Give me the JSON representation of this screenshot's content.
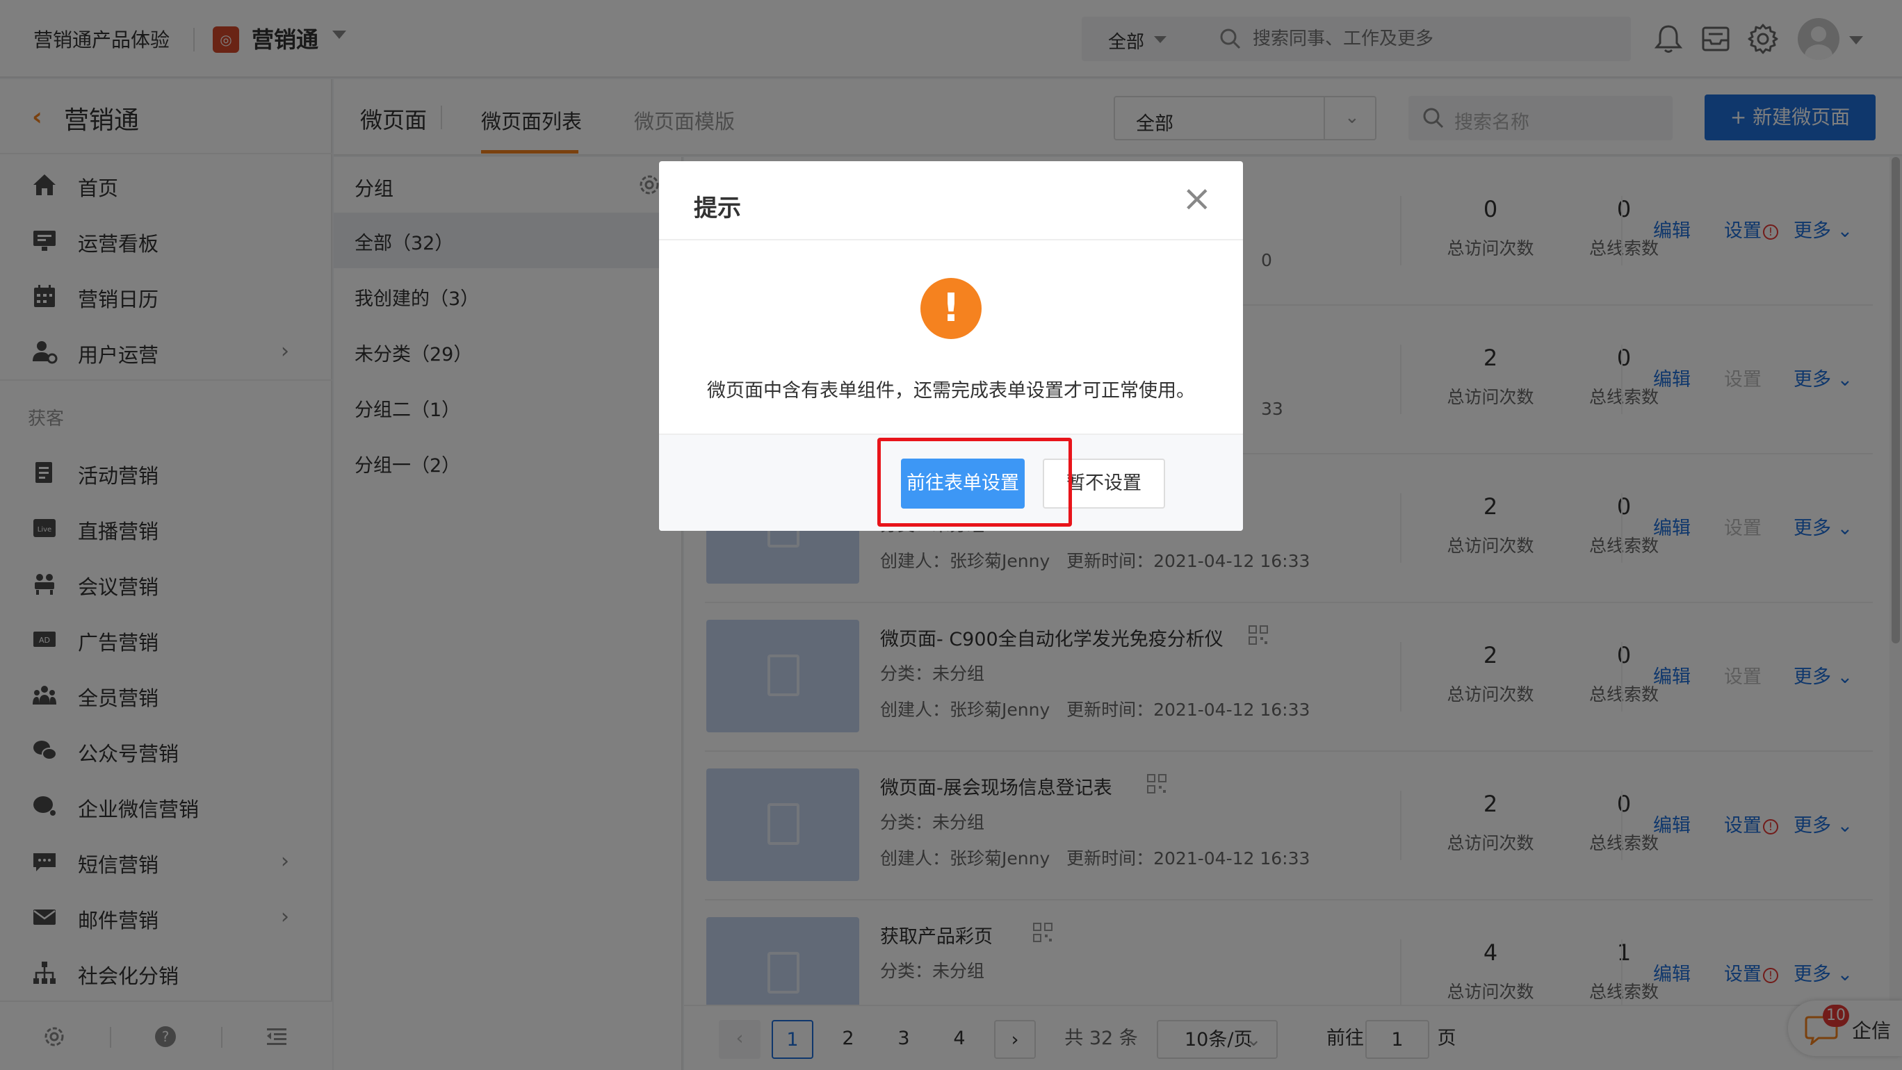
{
  "topbar": {
    "product_label": "营销通产品体验",
    "app_name": "营销通",
    "search_scope": "全部",
    "search_placeholder": "搜索同事、工作及更多"
  },
  "sidebar": {
    "title": "营销通",
    "items": [
      {
        "label": "首页",
        "icon": "home-icon"
      },
      {
        "label": "运营看板",
        "icon": "dashboard-icon"
      },
      {
        "label": "营销日历",
        "icon": "calendar-icon"
      },
      {
        "label": "用户运营",
        "icon": "user-gear-icon",
        "has_children": true
      }
    ],
    "section_label": "获客",
    "section_items": [
      {
        "label": "活动营销",
        "icon": "activity-icon"
      },
      {
        "label": "直播营销",
        "icon": "live-icon"
      },
      {
        "label": "会议营销",
        "icon": "meeting-icon"
      },
      {
        "label": "广告营销",
        "icon": "ad-icon"
      },
      {
        "label": "全员营销",
        "icon": "team-icon"
      },
      {
        "label": "公众号营销",
        "icon": "wechat-icon"
      },
      {
        "label": "企业微信营销",
        "icon": "wecom-icon"
      },
      {
        "label": "短信营销",
        "icon": "sms-icon",
        "has_children": true
      },
      {
        "label": "邮件营销",
        "icon": "mail-icon",
        "has_children": true
      },
      {
        "label": "社会化分销",
        "icon": "distribution-icon"
      }
    ]
  },
  "content_header": {
    "title": "微页面",
    "tabs": [
      {
        "label": "微页面列表",
        "active": true
      },
      {
        "label": "微页面模版",
        "active": false
      }
    ],
    "filter_value": "全部",
    "search_placeholder": "搜索名称",
    "new_button": "+ 新建微页面"
  },
  "groups": {
    "header": "分组",
    "items": [
      {
        "label": "全部（32）",
        "selected": true
      },
      {
        "label": "我创建的（3）",
        "selected": false
      },
      {
        "label": "未分类（29）",
        "selected": false
      },
      {
        "label": "分组二（1）",
        "selected": false
      },
      {
        "label": "分组一（2）",
        "selected": false
      }
    ]
  },
  "list": {
    "visits_label": "总访问次数",
    "leads_label": "总线索数",
    "edit_label": "编辑",
    "settings_label": "设置",
    "more_label": "更多",
    "category_prefix": "分类：",
    "creator_prefix": "创建人：",
    "updated_prefix": "更新时间：",
    "rows": [
      {
        "name": "",
        "category": "",
        "creator": "",
        "updated": "",
        "visits": "0",
        "leads": "0",
        "settings_warn": true,
        "settings_enabled": true,
        "partial_meta": "0"
      },
      {
        "name": "",
        "category": "",
        "creator": "",
        "updated": "",
        "visits": "2",
        "leads": "0",
        "settings_warn": false,
        "settings_enabled": false,
        "partial_meta": "33"
      },
      {
        "name": "",
        "category": "未分组",
        "creator": "张珍菊Jenny",
        "updated": "2021-04-12 16:33",
        "visits": "2",
        "leads": "0",
        "settings_warn": false,
        "settings_enabled": false
      },
      {
        "name": "微页面- C900全自动化学发光免疫分析仪",
        "category": "未分组",
        "creator": "张珍菊Jenny",
        "updated": "2021-04-12 16:33",
        "visits": "2",
        "leads": "0",
        "settings_warn": false,
        "settings_enabled": false
      },
      {
        "name": "微页面-展会现场信息登记表",
        "category": "未分组",
        "creator": "张珍菊Jenny",
        "updated": "2021-04-12 16:33",
        "visits": "2",
        "leads": "0",
        "settings_warn": true,
        "settings_enabled": true
      },
      {
        "name": "获取产品彩页",
        "category": "未分组",
        "creator": "",
        "updated": "",
        "visits": "4",
        "leads": "1",
        "settings_warn": true,
        "settings_enabled": true
      }
    ]
  },
  "pager": {
    "pages": [
      "1",
      "2",
      "3",
      "4"
    ],
    "current": "1",
    "total": "共 32 条",
    "page_size": "10条/页",
    "goto_label": "前往",
    "goto_value": "1",
    "goto_suffix": "页"
  },
  "qixin": {
    "badge": "10",
    "label": "企信"
  },
  "modal": {
    "title": "提示",
    "message": "微页面中含有表单组件，还需完成表单设置才可正常使用。",
    "primary_button": "前往表单设置",
    "secondary_button": "暂不设置"
  },
  "colors": {
    "accent_orange": "#f5821f",
    "primary_blue": "#1e6fd9",
    "button_blue": "#3d97f5",
    "highlight_red": "#e8141a"
  }
}
